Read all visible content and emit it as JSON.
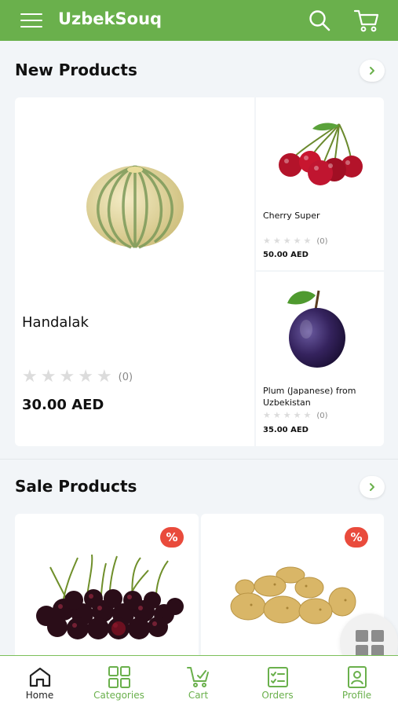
{
  "app": {
    "title": "UzbekSouq"
  },
  "colors": {
    "brand": "#6ab04c",
    "badge": "#e94b3c"
  },
  "new_products": {
    "title": "New Products",
    "items": [
      {
        "name": "Handalak",
        "rating_count": "(0)",
        "price": "30.00 AED",
        "image": "melon"
      },
      {
        "name": "Cherry Super",
        "rating_count": "(0)",
        "price": "50.00 AED",
        "image": "cherries"
      },
      {
        "name": "Plum (Japanese) from Uzbekistan",
        "rating_count": "(0)",
        "price": "35.00 AED",
        "image": "plum"
      }
    ]
  },
  "sale_products": {
    "title": "Sale Products",
    "items": [
      {
        "badge": "%",
        "image": "black-cherries"
      },
      {
        "badge": "%",
        "image": "potatoes"
      }
    ]
  },
  "bottom_nav": [
    {
      "label": "Home",
      "icon": "home-icon",
      "active": true
    },
    {
      "label": "Categories",
      "icon": "grid-icon",
      "active": false
    },
    {
      "label": "Cart",
      "icon": "cart-icon",
      "active": false
    },
    {
      "label": "Orders",
      "icon": "orders-icon",
      "active": false
    },
    {
      "label": "Profile",
      "icon": "profile-icon",
      "active": false
    }
  ]
}
